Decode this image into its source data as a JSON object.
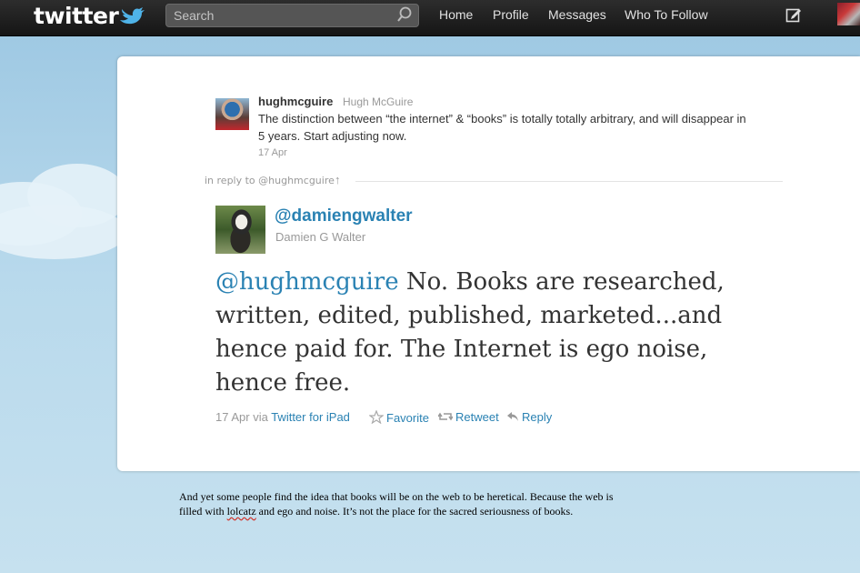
{
  "header": {
    "logo_text": "twitter",
    "search_placeholder": "Search",
    "nav": [
      "Home",
      "Profile",
      "Messages",
      "Who To Follow"
    ]
  },
  "original_tweet": {
    "username": "hughmcguire",
    "fullname": "Hugh McGuire",
    "text": "The distinction between “the internet” & “books” is totally totally arbitrary, and will disappear in 5 years. Start adjusting now.",
    "date": "17 Apr"
  },
  "in_reply": {
    "label": "in reply to @hughmcguire",
    "arrow": "↑"
  },
  "reply_tweet": {
    "username": "@damiengwalter",
    "fullname": "Damien G Walter",
    "mention": "@hughmcguire",
    "text": " No. Books are researched, written, edited, published, marketed...and hence paid for. The Internet is ego noise, hence free.",
    "date_via": "17 Apr via ",
    "client": "Twitter for iPad",
    "actions": {
      "favorite": "Favorite",
      "retweet": "Retweet",
      "reply": "Reply"
    }
  },
  "caption": {
    "before": "And yet some people find the idea that books will be on the web to be heretical. Because the web is filled with ",
    "misspelled": "lolcatz",
    "after": " and ego and noise. It’s not the place for the sacred seriousness of books."
  },
  "colors": {
    "link": "#2a82b3",
    "topbar": "#1e1e1e",
    "background": "#c0deed"
  },
  "icons": [
    "twitter-bird-icon",
    "search-icon",
    "compose-icon",
    "star-icon",
    "retweet-icon",
    "reply-icon"
  ]
}
